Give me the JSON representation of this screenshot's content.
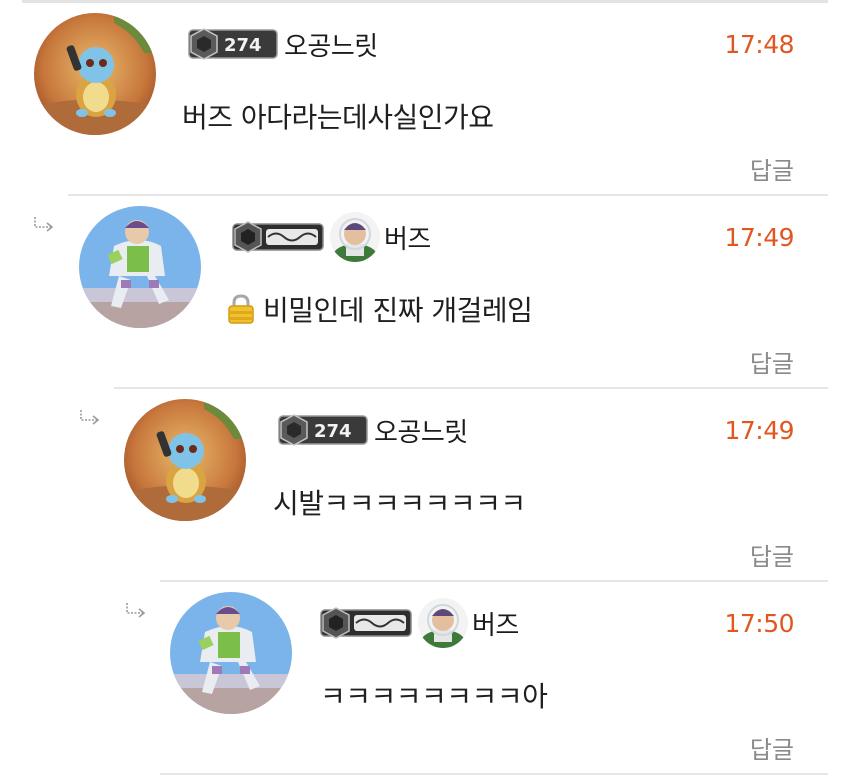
{
  "colors": {
    "time": "#e2571f",
    "reply": "#8a8a8a",
    "divider": "#e6e6e6"
  },
  "comments": [
    {
      "username": "오공느릿",
      "level": "274",
      "time": "17:48",
      "text": "버즈 아다라는데사실인가요",
      "reply_label": "답글",
      "avatar": "squirtle-avatar"
    },
    {
      "username": "버즈",
      "time": "17:49",
      "text": "비밀인데 진짜 개걸레임",
      "reply_label": "답글",
      "avatar": "buzz-avatar",
      "secret_icon": "lock-icon"
    },
    {
      "username": "오공느릿",
      "level": "274",
      "time": "17:49",
      "text": "시발ㅋㅋㅋㅋㅋㅋㅋㅋ",
      "reply_label": "답글",
      "avatar": "squirtle-avatar"
    },
    {
      "username": "버즈",
      "time": "17:50",
      "text": "ㅋㅋㅋㅋㅋㅋㅋㅋ아",
      "reply_label": "답글",
      "avatar": "buzz-avatar"
    }
  ]
}
